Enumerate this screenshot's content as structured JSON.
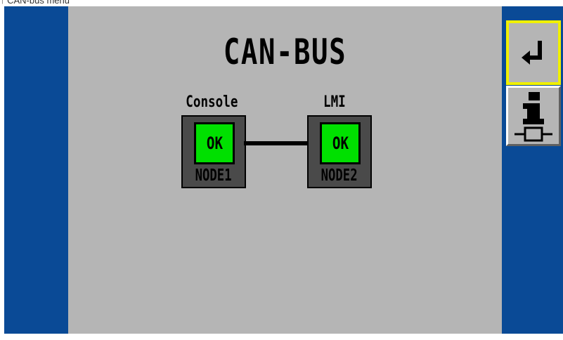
{
  "caption": "↑ CAN-bus menu",
  "screen": {
    "title": "CAN-BUS",
    "nodes": [
      {
        "label": "Console",
        "status": "OK",
        "name": "NODE1"
      },
      {
        "label": "LMI",
        "status": "OK",
        "name": "NODE2"
      }
    ]
  },
  "sidebar": {
    "buttons": [
      {
        "icon": "return-arrow-icon",
        "state": "selected"
      },
      {
        "icon": "info-node-icon"
      }
    ]
  },
  "colors": {
    "background": "#0a4a96",
    "panel": "#b5b5b5",
    "status_ok": "#00e000",
    "selected_border": "#f0f000"
  }
}
